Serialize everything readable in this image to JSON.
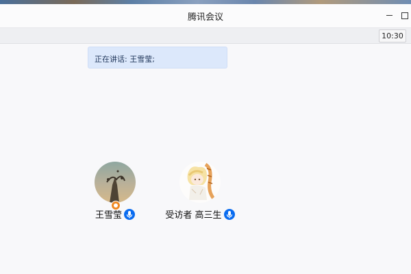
{
  "window": {
    "title": "腾讯会议",
    "clock": "10:30"
  },
  "meeting": {
    "speaking_label": "正在讲话: 王雪莹;"
  },
  "participants": [
    {
      "name": "王雪莹",
      "is_host": true,
      "mic": "mic-on-icon",
      "avatar": "avatar-landscape"
    },
    {
      "name": "受访者 高三生",
      "is_host": false,
      "mic": "mic-on-icon",
      "avatar": "avatar-anime-character"
    }
  ],
  "colors": {
    "mic_blue": "#0a6cf0",
    "banner_bg": "#dce8fb",
    "host_badge": "#f08a24"
  }
}
